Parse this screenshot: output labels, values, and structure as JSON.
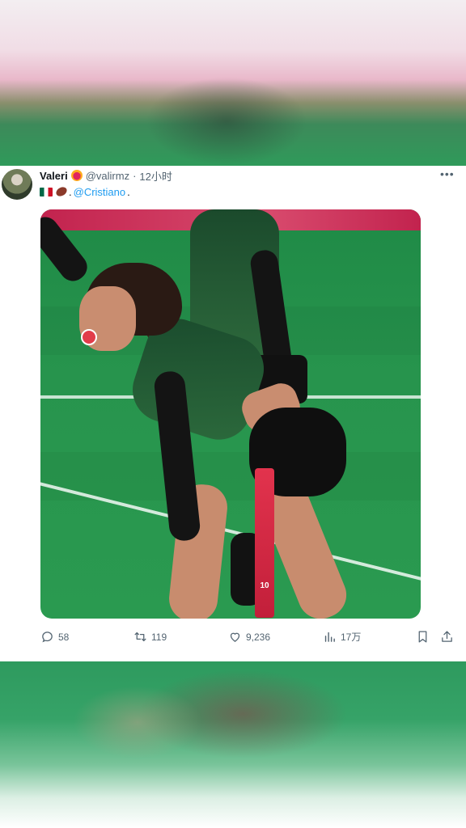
{
  "tweet": {
    "display_name": "Valeri",
    "handle": "@valirmz",
    "separator": "·",
    "time": "12小时",
    "more_glyph": "•••",
    "text_separator": ".",
    "mention": "@Cristiano",
    "text_suffix": ".",
    "media_jersey_number": "10"
  },
  "actions": {
    "replies": "58",
    "retweets": "119",
    "likes": "9,236",
    "views": "17万"
  },
  "icons": [
    "reply-icon",
    "retweet-icon",
    "like-icon",
    "views-icon",
    "bookmark-icon",
    "share-icon",
    "more-icon"
  ],
  "colors": {
    "link": "#1d9bf0",
    "text_primary": "#0f1419",
    "text_secondary": "#536471"
  }
}
